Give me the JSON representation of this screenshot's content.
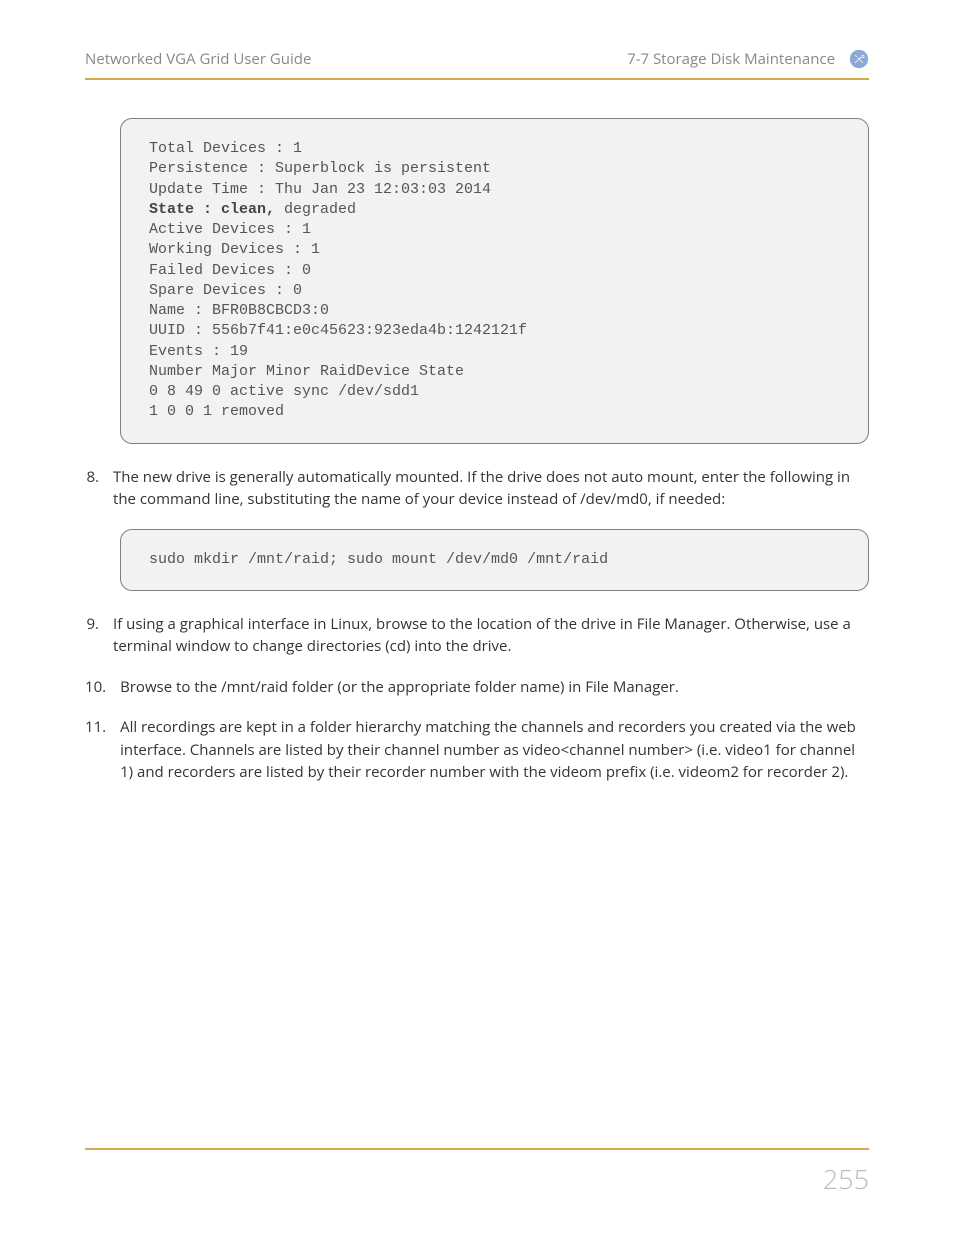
{
  "header": {
    "left": "Networked VGA Grid User Guide",
    "right": "7-7 Storage Disk Maintenance"
  },
  "code1": {
    "line1": "Total Devices : 1",
    "line2": "Persistence : Superblock is persistent",
    "line3": "Update Time : Thu Jan 23 12:03:03 2014",
    "line4_bold": "State : clean,",
    "line4_rest": " degraded",
    "line5": "Active Devices : 1",
    "line6": "Working Devices : 1",
    "line7": "Failed Devices : 0",
    "line8": "Spare Devices : 0",
    "line9": "Name : BFR0B8CBCD3:0",
    "line10": "UUID : 556b7f41:e0c45623:923eda4b:1242121f",
    "line11": "Events : 19",
    "line12": "Number Major Minor RaidDevice State",
    "line13": "0 8 49 0 active sync /dev/sdd1",
    "line14": "1 0 0 1 removed"
  },
  "steps": [
    {
      "num": "  8.",
      "text": "The new drive is generally automatically mounted. If the drive does not auto mount, enter the following in the command line, substituting the name of your device instead of /dev/md0, if needed:"
    },
    {
      "num": "  9.",
      "text": "If using a graphical interface in Linux, browse to the location of the drive in File Manager. Otherwise, use a terminal window to change directories (cd) into the drive."
    },
    {
      "num": "10.",
      "text": "Browse to the /mnt/raid folder (or the appropriate folder name) in File Manager."
    },
    {
      "num": "11.",
      "text": "All recordings are kept in a folder hierarchy matching the channels and recorders you created via the web interface. Channels are listed by their channel number as video<channel number> (i.e. video1 for channel 1) and recorders are listed by their recorder number with the videom prefix (i.e. videom2 for recorder 2)."
    }
  ],
  "code2": "sudo mkdir /mnt/raid; sudo mount /dev/md0 /mnt/raid",
  "page_num": "255"
}
